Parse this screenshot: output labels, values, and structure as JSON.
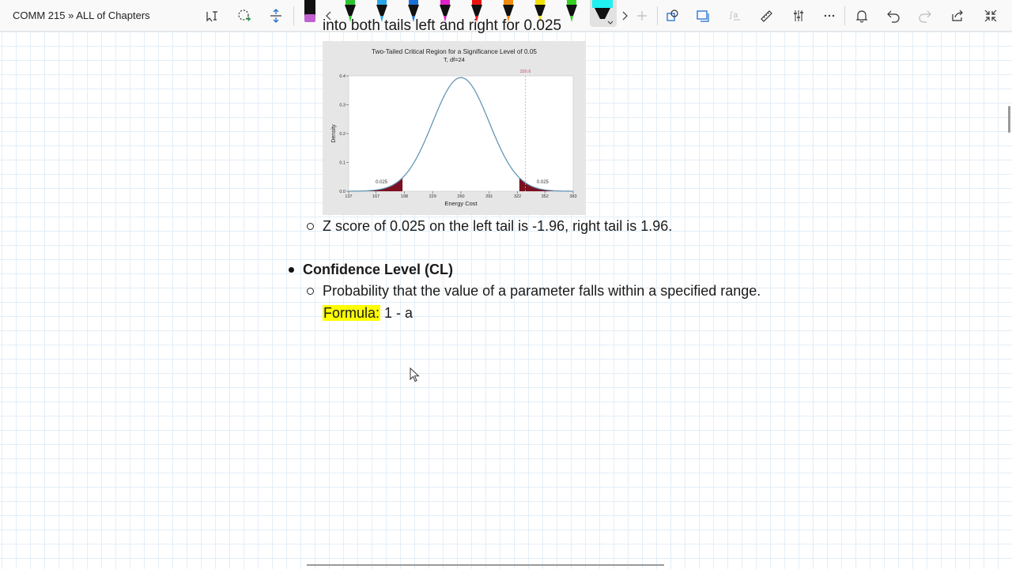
{
  "toolbar": {
    "notebook_title": "COMM 215 » ALL of Chapters",
    "tools": {
      "ink_to_text": "ink-to-text-icon",
      "lasso": "lasso-select-icon",
      "add_space": "add-space-icon",
      "scroll_left": "chevron-left-icon",
      "scroll_right": "chevron-right-icon",
      "add_pen": "plus-icon",
      "ink_to_shape": "ink-to-shape-icon",
      "ink_to_math": "ink-to-math-icon",
      "ruler": "ruler-icon",
      "mixer": "settings-icon",
      "more": "more-icon",
      "notifications": "bell-icon",
      "undo": "undo-icon",
      "redo": "redo-icon",
      "share": "share-icon",
      "collapse": "collapse-icon"
    },
    "pens": [
      {
        "name": "pen-black",
        "color": "#111111"
      },
      {
        "name": "pen-green",
        "color": "#2fc42f"
      },
      {
        "name": "pen-light-blue",
        "color": "#28a6e8"
      },
      {
        "name": "pen-blue",
        "color": "#1b6fd8"
      },
      {
        "name": "pen-magenta",
        "color": "#e020c8"
      },
      {
        "name": "pen-red",
        "color": "#e81414"
      },
      {
        "name": "pen-orange",
        "color": "#f08a10"
      },
      {
        "name": "pen-yellow",
        "color": "#f2e000"
      },
      {
        "name": "pen-lime",
        "color": "#34d11e"
      },
      {
        "name": "highlighter-cyan",
        "color": "#20f0f0"
      }
    ]
  },
  "content": {
    "clipped_line": "into both tails left and right for 0.025",
    "z_score_line": "Z score of 0.025 on the left tail is -1.96, right tail is 1.96.",
    "cl_heading": "Confidence Level (CL)",
    "cl_definition": "Probability that the value of a parameter falls within a specified range.",
    "formula_label": "Formula:",
    "formula_value": " 1 - a"
  },
  "chart_data": {
    "type": "area",
    "title": "Two-Tailed Critical Region for a Significance Level of 0.05",
    "subtitle": "T, df=24",
    "xlabel": "Energy Cost",
    "ylabel": "Density",
    "x_ticks": [
      "137",
      "167",
      "198",
      "229",
      "260",
      "291",
      "322",
      "352",
      "383"
    ],
    "y_ticks": [
      "0.0",
      "0.1",
      "0.2",
      "0.3",
      "0.4"
    ],
    "ylim": [
      0,
      0.4
    ],
    "xlim": [
      137,
      383
    ],
    "mean": 260,
    "sd": 31,
    "critical_left": 196,
    "critical_right": 324,
    "reference_line": {
      "x": 330.6,
      "label": "330.6"
    },
    "tail_labels": [
      "0.025",
      "0.025"
    ],
    "tail_color": "#7a1020",
    "curve_color": "#5a8fb0"
  }
}
